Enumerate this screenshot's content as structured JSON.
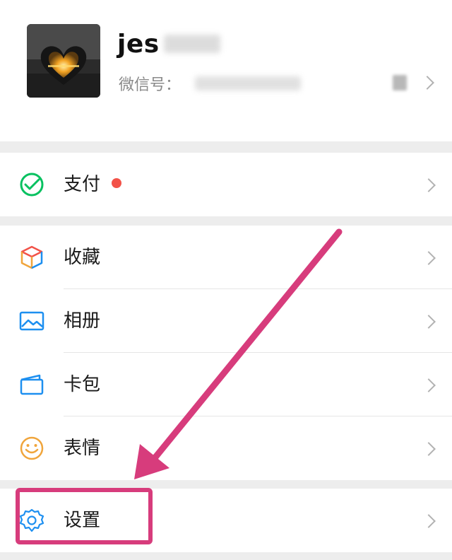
{
  "profile": {
    "nickname": "jes",
    "wechat_id_label": "微信号："
  },
  "pay": {
    "label": "支付"
  },
  "menu": {
    "favorites": "收藏",
    "album": "相册",
    "cards": "卡包",
    "stickers": "表情",
    "settings": "设置"
  },
  "colors": {
    "pay_green": "#07c160",
    "badge_red": "#f25248",
    "annotation_pink": "#d73c7c",
    "icon_blue": "#1d8ff0",
    "icon_orange": "#f0a53c"
  },
  "icons": {
    "pay": "wechat-pay-icon",
    "favorites": "cube-icon",
    "album": "picture-icon",
    "cards": "wallet-card-icon",
    "stickers": "smiley-icon",
    "settings": "gear-icon",
    "row_arrow": "chevron-right-icon"
  }
}
